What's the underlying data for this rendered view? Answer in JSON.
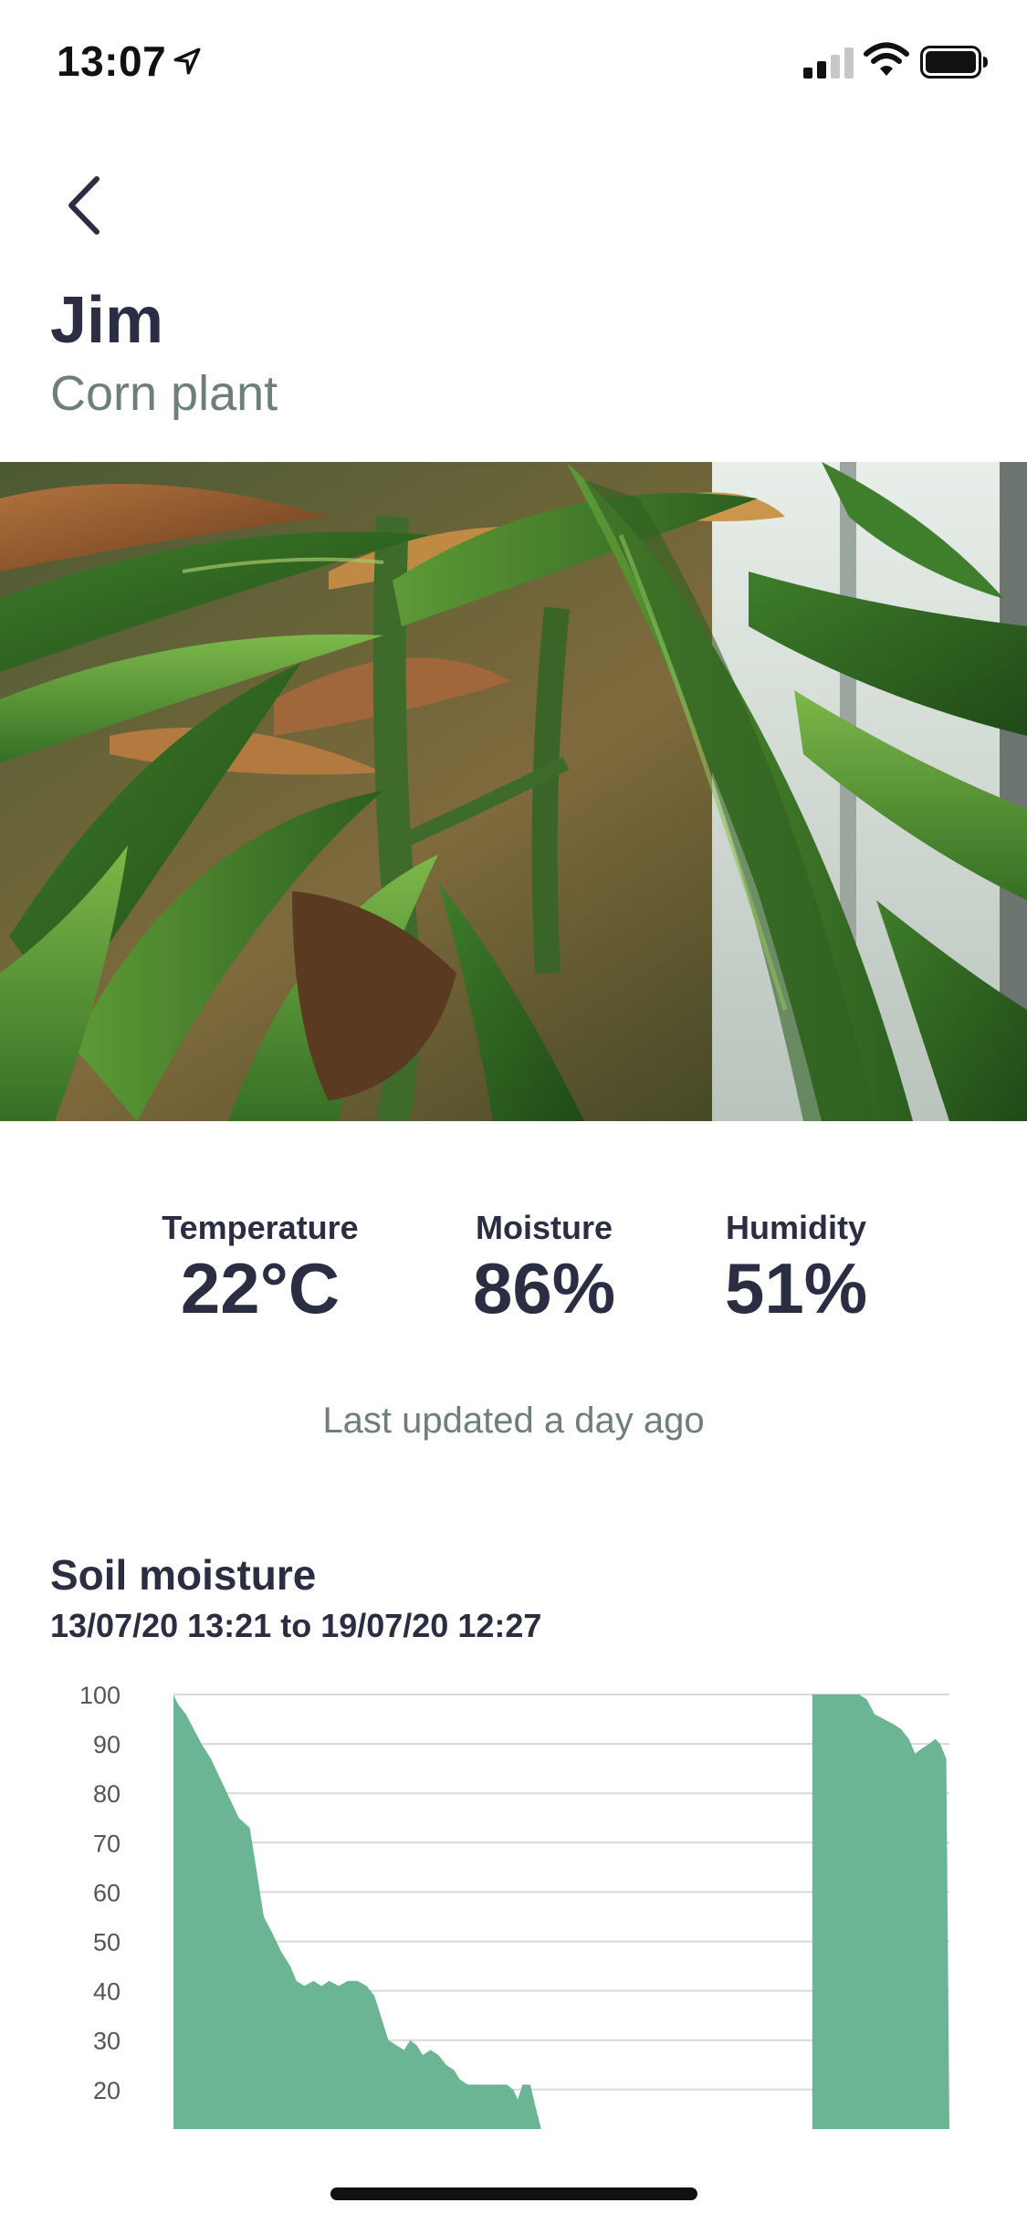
{
  "status_bar": {
    "time": "13:07",
    "icons": [
      "location-arrow-icon",
      "cellular-signal-icon",
      "wifi-icon",
      "battery-icon"
    ]
  },
  "nav": {
    "back_icon": "chevron-left-icon"
  },
  "plant": {
    "name": "Jim",
    "type": "Corn plant"
  },
  "stats": [
    {
      "label": "Temperature",
      "value": "22°C"
    },
    {
      "label": "Moisture",
      "value": "86%"
    },
    {
      "label": "Humidity",
      "value": "51%"
    }
  ],
  "last_updated": "Last updated a day ago",
  "chart_section": {
    "title": "Soil moisture",
    "range": "13/07/20 13:21 to 19/07/20 12:27"
  },
  "colors": {
    "accent": "#6bb594",
    "text_dark": "#2b2d42",
    "text_muted": "#6e7f78",
    "grid": "#d9d9d9"
  },
  "chart_data": {
    "type": "area",
    "title": "Soil moisture",
    "xlabel": "",
    "ylabel": "",
    "ylim": [
      10,
      100
    ],
    "yticks": [
      100,
      90,
      80,
      70,
      60,
      50,
      40,
      30,
      20
    ],
    "grid": true,
    "series": [
      {
        "values": [
          [
            0.0,
            100
          ],
          [
            0.3,
            98
          ],
          [
            0.8,
            96
          ],
          [
            1.3,
            93
          ],
          [
            1.8,
            90
          ],
          [
            2.4,
            87
          ],
          [
            3.0,
            83
          ],
          [
            3.6,
            79
          ],
          [
            4.2,
            75
          ],
          [
            4.9,
            73
          ],
          [
            5.2,
            67
          ],
          [
            5.8,
            55
          ],
          [
            6.3,
            52
          ],
          [
            6.9,
            48
          ],
          [
            7.5,
            45
          ],
          [
            7.9,
            42
          ],
          [
            8.4,
            41
          ],
          [
            9.0,
            42
          ],
          [
            9.5,
            41
          ],
          [
            10.0,
            42
          ],
          [
            10.6,
            41
          ],
          [
            11.2,
            42
          ],
          [
            11.8,
            42
          ],
          [
            12.4,
            41
          ],
          [
            12.9,
            39
          ],
          [
            13.4,
            34
          ],
          [
            13.8,
            30
          ],
          [
            14.3,
            29
          ],
          [
            14.8,
            28
          ],
          [
            15.2,
            30
          ],
          [
            15.6,
            29
          ],
          [
            16.0,
            27
          ],
          [
            16.5,
            28
          ],
          [
            17.0,
            27
          ],
          [
            17.5,
            25
          ],
          [
            18.0,
            24
          ],
          [
            18.4,
            22
          ],
          [
            18.9,
            21
          ],
          [
            19.5,
            21
          ],
          [
            20.1,
            21
          ],
          [
            20.8,
            21
          ],
          [
            21.4,
            21
          ],
          [
            21.8,
            20
          ],
          [
            22.1,
            18
          ],
          [
            22.4,
            21
          ],
          [
            22.9,
            21
          ],
          [
            23.2,
            17
          ],
          [
            23.6,
            12
          ]
        ]
      },
      {
        "values": [
          [
            41.0,
            12
          ],
          [
            41.0,
            100
          ],
          [
            42.0,
            100
          ],
          [
            43.0,
            100
          ],
          [
            44.0,
            100
          ],
          [
            44.5,
            99
          ],
          [
            45.0,
            96
          ],
          [
            45.6,
            95
          ],
          [
            46.2,
            94
          ],
          [
            46.7,
            93
          ],
          [
            47.2,
            91
          ],
          [
            47.6,
            88
          ],
          [
            48.0,
            89
          ],
          [
            48.5,
            90
          ],
          [
            48.9,
            91
          ],
          [
            49.2,
            90
          ],
          [
            49.6,
            87
          ],
          [
            49.8,
            12
          ]
        ]
      }
    ]
  }
}
